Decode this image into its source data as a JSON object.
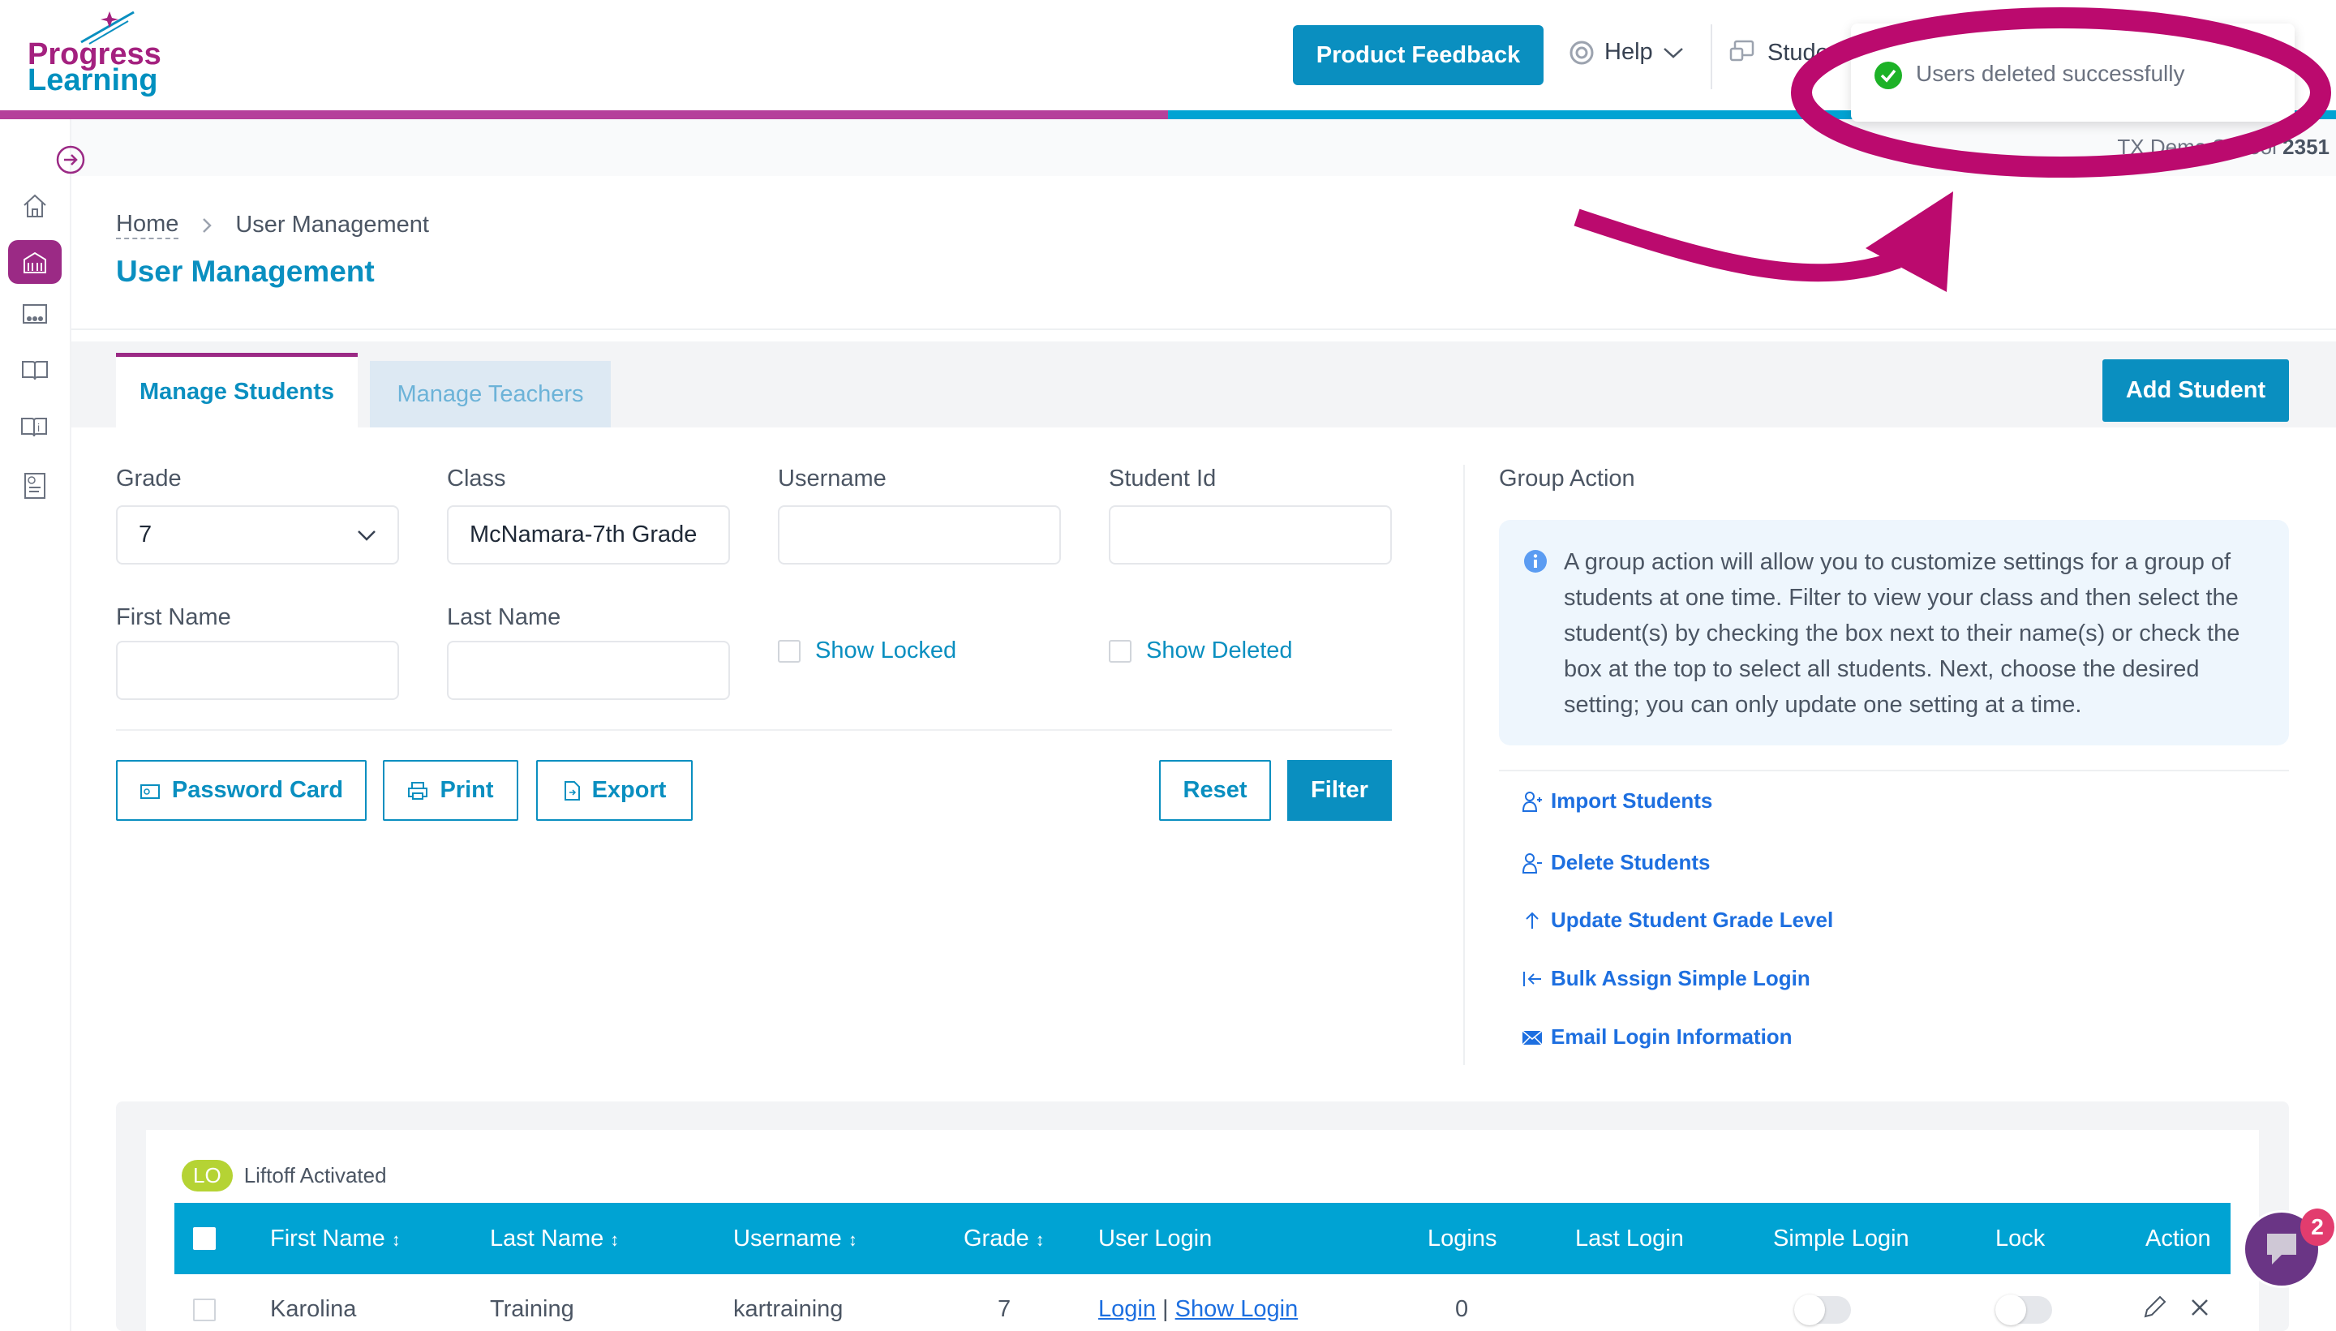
{
  "header": {
    "logo_line1": "Progress",
    "logo_line2": "Learning",
    "product_feedback": "Product Feedback",
    "help": "Help",
    "students_menu": "Stude",
    "school_name": "TX Demo School",
    "school_id": "2351"
  },
  "toast": {
    "message": "Users deleted successfully",
    "status": "success",
    "color": "#1db227"
  },
  "annotation": {
    "color": "#bb0a6e",
    "shape": "ellipse-and-arrow"
  },
  "sidebar": {
    "items": [
      {
        "icon": "collapse-arrow-icon"
      },
      {
        "icon": "home-icon"
      },
      {
        "icon": "school-icon",
        "active": true
      },
      {
        "icon": "classroom-icon"
      },
      {
        "icon": "book-icon"
      },
      {
        "icon": "book-info-icon"
      },
      {
        "icon": "report-icon"
      }
    ]
  },
  "breadcrumb": {
    "home": "Home",
    "current": "User Management"
  },
  "page_title": "User Management",
  "tabs": [
    {
      "label": "Manage Students",
      "active": true
    },
    {
      "label": "Manage Teachers",
      "active": false
    }
  ],
  "add_student": "Add Student",
  "filters": {
    "grade": {
      "label": "Grade",
      "value": "7"
    },
    "class": {
      "label": "Class",
      "value": "McNamara-7th Grade"
    },
    "username": {
      "label": "Username",
      "value": ""
    },
    "student_id": {
      "label": "Student Id",
      "value": ""
    },
    "first_name": {
      "label": "First Name",
      "value": ""
    },
    "last_name": {
      "label": "Last Name",
      "value": ""
    },
    "show_locked": {
      "label": "Show Locked",
      "checked": false
    },
    "show_deleted": {
      "label": "Show Deleted",
      "checked": false
    }
  },
  "actions": {
    "password_card": "Password Card",
    "print": "Print",
    "export": "Export",
    "reset": "Reset",
    "filter": "Filter"
  },
  "group_action": {
    "title": "Group Action",
    "info": "A group action will allow you to customize settings for a group of students at one time. Filter to view your class and then select the student(s) by checking the box next to their name(s) or check the box at the top to select all students. Next, choose the desired setting; you can only update one setting at a time.",
    "links": [
      "Import Students",
      "Delete Students",
      "Update Student Grade Level",
      "Bulk Assign Simple Login",
      "Email Login Information"
    ]
  },
  "table": {
    "legend_badge": "LO",
    "legend_label": "Liftoff Activated",
    "columns": [
      "First Name",
      "Last Name",
      "Username",
      "Grade",
      "User Login",
      "Logins",
      "Last Login",
      "Simple Login",
      "Lock",
      "Action"
    ],
    "sort_icon": "↕",
    "rows": [
      {
        "first_name": "Karolina",
        "last_name": "Training",
        "username": "kartraining",
        "grade": "7",
        "login": "Login",
        "sep": "|",
        "show_login": "Show Login",
        "logins": "0",
        "last_login": "",
        "simple_login": false,
        "lock": false
      }
    ]
  },
  "chat": {
    "badge": "2"
  },
  "colors": {
    "primary": "#0a8fc0",
    "magenta": "#9b2a85",
    "header_table": "#00a3d3",
    "link": "#1d6fe0"
  }
}
